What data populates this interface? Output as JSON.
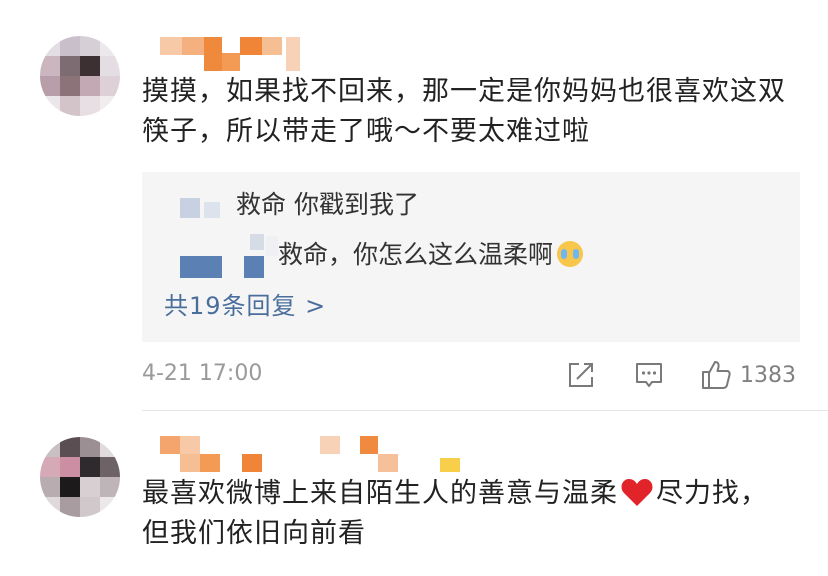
{
  "comments": [
    {
      "text": "摸摸，如果找不回来，那一定是你妈妈也很喜欢这双筷子，所以带走了哦～不要太难过啦",
      "replies": [
        {
          "text": "救命 你戳到我了"
        },
        {
          "text": "救命，你怎么这么温柔啊"
        }
      ],
      "more_replies_label": "共19条回复 >",
      "timestamp": "4-21 17:00",
      "like_count": "1383"
    },
    {
      "text_before_heart": "最喜欢微博上来自陌生人的善意与温柔",
      "text_after_heart": "尽力找，但我们依旧向前看"
    }
  ],
  "icons": {
    "repost": "repost-icon",
    "comment": "comment-icon",
    "like": "thumbs-up-icon",
    "heart": "heart-emoji",
    "crying": "crying-face-emoji"
  },
  "colors": {
    "link_blue": "#4a6e9c",
    "meta_gray": "#9a9a9a",
    "reply_bg": "#f5f5f5",
    "heart_red": "#e0242a"
  }
}
